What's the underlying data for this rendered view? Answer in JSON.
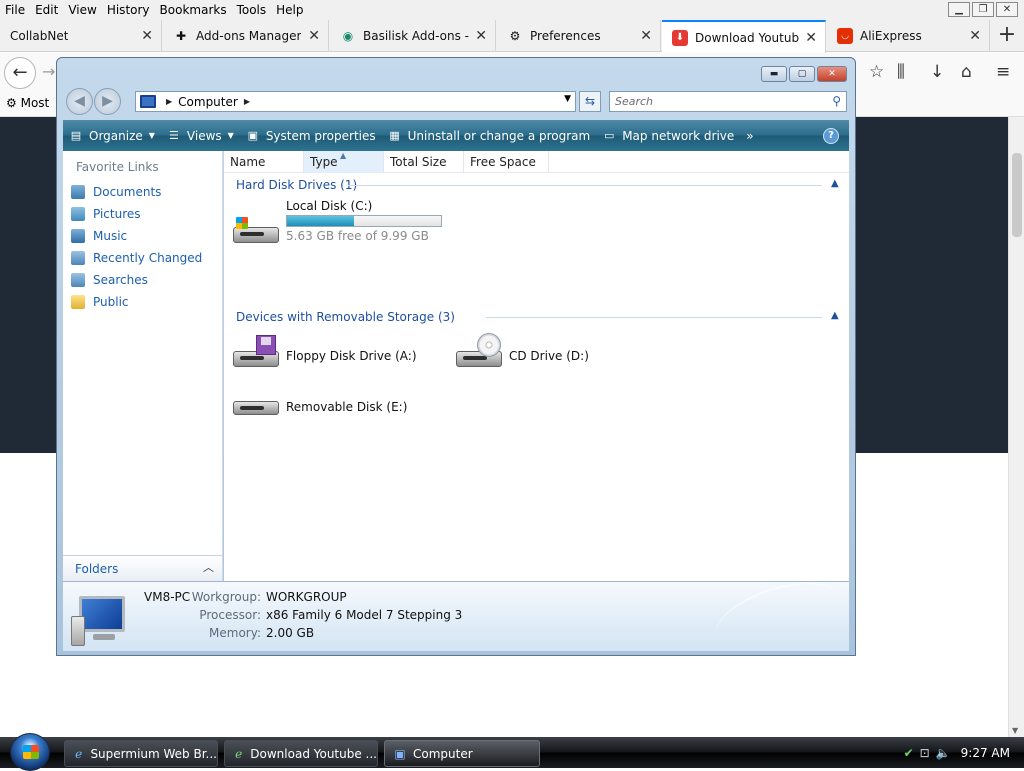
{
  "browser": {
    "menu": [
      {
        "label": "File"
      },
      {
        "label": "Edit"
      },
      {
        "label": "View"
      },
      {
        "label": "History"
      },
      {
        "label": "Bookmarks"
      },
      {
        "label": "Tools"
      },
      {
        "label": "Help"
      }
    ],
    "tabs": [
      {
        "title": "CollabNet",
        "icon": "page-icon"
      },
      {
        "title": "Add-ons Manager",
        "icon": "puzzle-icon"
      },
      {
        "title": "Basilisk Add-ons -",
        "icon": "basilisk-icon"
      },
      {
        "title": "Preferences",
        "icon": "gear-icon"
      },
      {
        "title": "Download Youtube",
        "icon": "download-icon",
        "active": true
      },
      {
        "title": "AliExpress",
        "icon": "aliexpress-icon"
      }
    ],
    "bookmarks": {
      "most_visited_label": "Most"
    },
    "accent_color": "#0a84ff",
    "page_dark_color": "#1f2a36"
  },
  "explorer": {
    "address": {
      "location": "Computer"
    },
    "search": {
      "placeholder": "Search"
    },
    "toolbar": {
      "organize": "Organize",
      "views": "Views",
      "system_properties": "System properties",
      "uninstall": "Uninstall or change a program",
      "map_drive": "Map network drive",
      "more": "»",
      "help": "?"
    },
    "favorites": {
      "heading": "Favorite Links",
      "items": [
        {
          "label": "Documents",
          "icon": "documents-icon"
        },
        {
          "label": "Pictures",
          "icon": "pictures-icon"
        },
        {
          "label": "Music",
          "icon": "music-icon"
        },
        {
          "label": "Recently Changed",
          "icon": "recently-changed-icon"
        },
        {
          "label": "Searches",
          "icon": "searches-icon"
        },
        {
          "label": "Public",
          "icon": "public-folder-icon"
        }
      ]
    },
    "folders_label": "Folders",
    "columns": [
      "Name",
      "Type",
      "Total Size",
      "Free Space"
    ],
    "groups": {
      "hard_disks": {
        "title": "Hard Disk Drives (1)",
        "drives": [
          {
            "name": "Local Disk (C:)",
            "free": "5.63 GB free of 9.99 GB",
            "used_fraction": 0.436
          }
        ]
      },
      "removable": {
        "title": "Devices with Removable Storage (3)",
        "drives": [
          {
            "name": "Floppy Disk Drive (A:)"
          },
          {
            "name": "CD Drive (D:)"
          },
          {
            "name": "Removable Disk (E:)"
          }
        ]
      }
    },
    "details": {
      "pc_name": "VM8-PC",
      "workgroup_label": "Workgroup:",
      "workgroup": "WORKGROUP",
      "processor_label": "Processor:",
      "processor": "x86 Family 6 Model 7 Stepping 3",
      "memory_label": "Memory:",
      "memory": "2.00 GB"
    }
  },
  "taskbar": {
    "buttons": [
      {
        "label": "Supermium Web Br...",
        "icon": "browser-icon"
      },
      {
        "label": "Download Youtube ...",
        "icon": "browser-icon"
      },
      {
        "label": "Computer",
        "icon": "computer-icon",
        "active": true
      }
    ],
    "clock": "9:27 AM"
  }
}
